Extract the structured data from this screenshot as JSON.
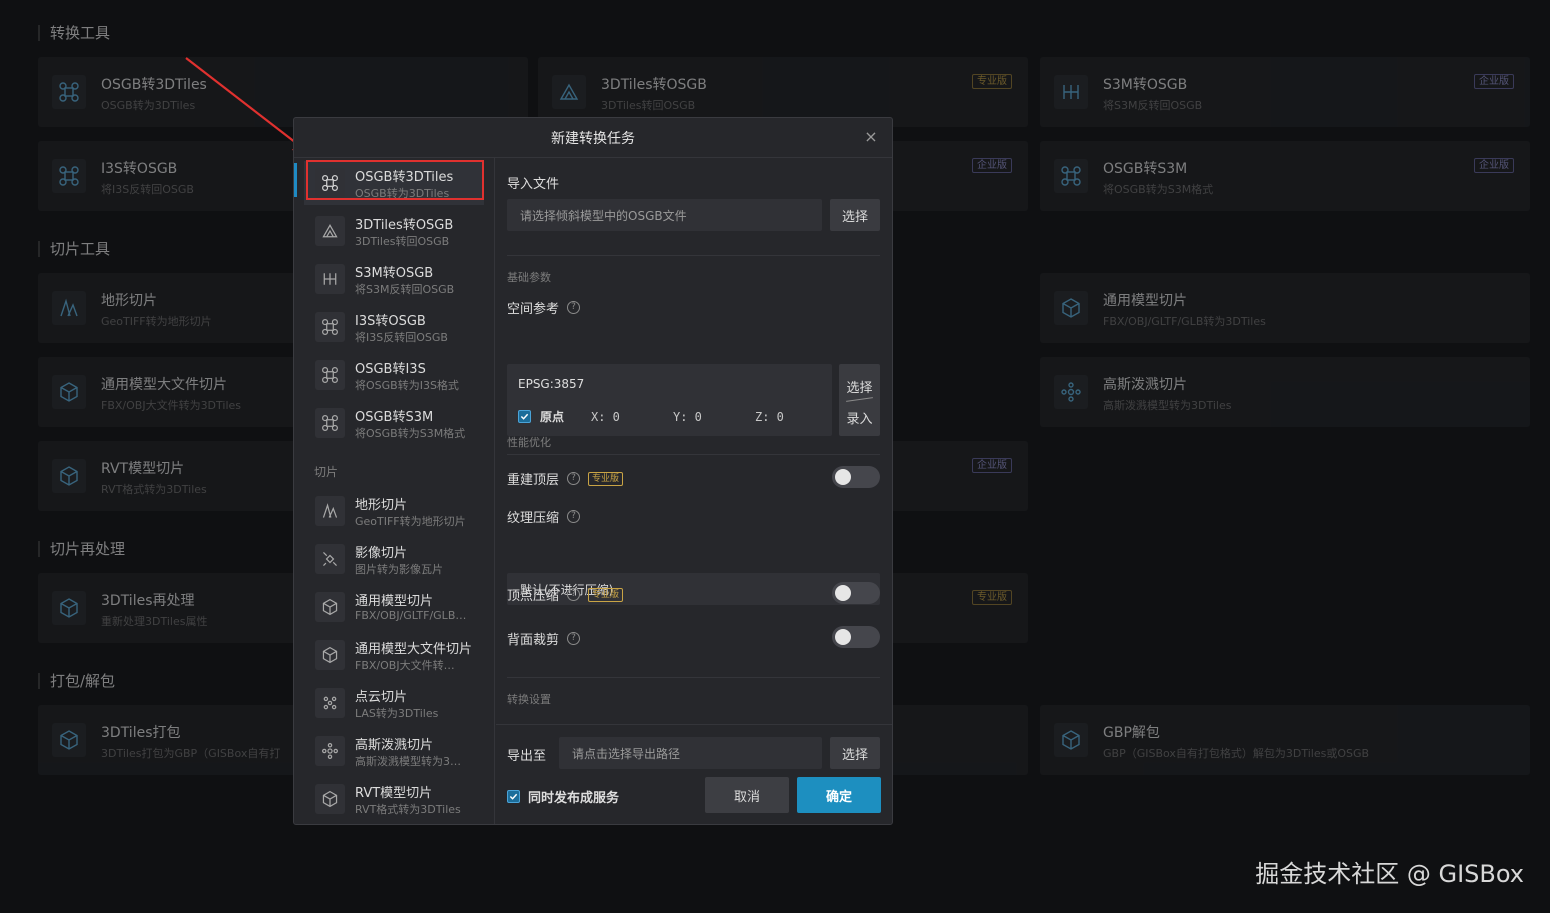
{
  "background": {
    "sections": [
      {
        "title": "转换工具"
      },
      {
        "title": "切片工具"
      },
      {
        "title": "切片再处理"
      },
      {
        "title": "打包/解包"
      }
    ],
    "cards": [
      {
        "title": "OSGB转3DTiles",
        "sub": "OSGB转为3DTiles",
        "badge": ""
      },
      {
        "title": "3DTiles转OSGB",
        "sub": "3DTiles转回OSGB",
        "badge": "专业版"
      },
      {
        "title": "S3M转OSGB",
        "sub": "将S3M反转回OSGB",
        "badge": "企业版"
      },
      {
        "title": "I3S转OSGB",
        "sub": "将I3S反转回OSGB",
        "badge": ""
      },
      {
        "title": "",
        "sub": "",
        "badge": "企业版"
      },
      {
        "title": "OSGB转S3M",
        "sub": "将OSGB转为S3M格式",
        "badge": "企业版"
      },
      {
        "title": "地形切片",
        "sub": "GeoTIFF转为地形切片",
        "badge": ""
      },
      {
        "title": "通用模型切片",
        "sub": "FBX/OBJ/GLTF/GLB转为3DTiles",
        "badge": ""
      },
      {
        "title": "通用模型大文件切片",
        "sub": "FBX/OBJ大文件转为3DTiles",
        "badge": ""
      },
      {
        "title": "高斯泼溅切片",
        "sub": "高斯泼溅模型转为3DTiles",
        "badge": ""
      },
      {
        "title": "RVT模型切片",
        "sub": "RVT格式转为3DTiles",
        "badge": ""
      },
      {
        "title": "",
        "sub": "",
        "badge": "企业版"
      },
      {
        "title": "3DTiles再处理",
        "sub": "重新处理3DTiles属性",
        "badge": ""
      },
      {
        "title": "",
        "sub": "",
        "badge": "专业版"
      },
      {
        "title": "3DTiles打包",
        "sub": "3DTiles打包为GBP（GISBox自有打",
        "badge": ""
      },
      {
        "title": "GBP解包",
        "sub": "GBP（GISBox自有打包格式）解包为3DTiles或OSGB",
        "badge": ""
      }
    ]
  },
  "modal": {
    "title": "新建转换任务",
    "close": "×",
    "sidebar": {
      "items": [
        {
          "title": "OSGB转3DTiles",
          "sub": "OSGB转为3DTiles"
        },
        {
          "title": "3DTiles转OSGB",
          "sub": "3DTiles转回OSGB"
        },
        {
          "title": "S3M转OSGB",
          "sub": "将S3M反转回OSGB"
        },
        {
          "title": "I3S转OSGB",
          "sub": "将I3S反转回OSGB"
        },
        {
          "title": "OSGB转I3S",
          "sub": "将OSGB转为I3S格式"
        },
        {
          "title": "OSGB转S3M",
          "sub": "将OSGB转为S3M格式"
        }
      ],
      "group2": "切片",
      "items2": [
        {
          "title": "地形切片",
          "sub": "GeoTIFF转为地形切片"
        },
        {
          "title": "影像切片",
          "sub": "图片转为影像瓦片"
        },
        {
          "title": "通用模型切片",
          "sub": "FBX/OBJ/GLTF/GLB…"
        },
        {
          "title": "通用模型大文件切片",
          "sub": "FBX/OBJ大文件转…"
        },
        {
          "title": "点云切片",
          "sub": "LAS转为3DTiles"
        },
        {
          "title": "高斯泼溅切片",
          "sub": "高斯泼溅模型转为3…"
        },
        {
          "title": "RVT模型切片",
          "sub": "RVT格式转为3DTiles"
        }
      ]
    },
    "form": {
      "import_label": "导入文件",
      "import_placeholder": "请选择倾斜模型中的OSGB文件",
      "select_btn": "选择",
      "basic_group": "基础参数",
      "srs_label": "空间参考",
      "srs_code": "EPSG:3857",
      "origin_label": "原点",
      "x": "X: 0",
      "y": "Y: 0",
      "z": "Z: 0",
      "srs_btn_top": "选择",
      "srs_btn_bottom": "录入",
      "perf_group": "性能优化",
      "rebuild_label": "重建顶层",
      "pro": "专业版",
      "texture_label": "纹理压缩",
      "texture_value": "默认(不进行压缩)",
      "vertex_label": "顶点压缩",
      "backface_label": "背面裁剪",
      "convert_group": "转换设置"
    },
    "footer": {
      "export_label": "导出至",
      "export_placeholder": "请点击选择导出路径",
      "select_btn": "选择",
      "publish_label": "同时发布成服务",
      "cancel": "取消",
      "ok": "确定"
    }
  },
  "watermark": "掘金技术社区 @ GISBox",
  "colors": {
    "accent": "#1d8fc0",
    "highlight": "#e0312f",
    "pro_badge": "#c9a445"
  }
}
